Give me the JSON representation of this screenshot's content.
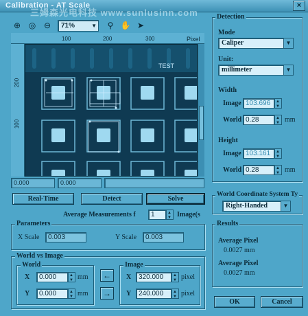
{
  "window": {
    "title": "Calibration - AT Scale",
    "watermark": "三姆森光电科技 www.sunlusinn.com",
    "close_label": "×"
  },
  "toolbar": {
    "zoom": "71%",
    "pixel_label": "Pixel"
  },
  "ruler": {
    "x": [
      "100",
      "200",
      "300"
    ],
    "y": [
      "200",
      "100"
    ]
  },
  "image": {
    "annotation": "TEST"
  },
  "status": {
    "a": "0.000",
    "b": "0.000"
  },
  "buttons": {
    "realtime": "Real-Time",
    "detect": "Detect",
    "solve": "Solve",
    "ok": "OK",
    "cancel": "Cancel",
    "arrow_left": "←",
    "arrow_right": "→"
  },
  "avg": {
    "label": "Average Measurements f",
    "value": "1",
    "suffix": "Image(s"
  },
  "parameters": {
    "title": "Parameters",
    "x_label": "X Scale",
    "x_value": "0.003",
    "y_label": "Y Scale",
    "y_value": "0.003"
  },
  "world_vs_image": {
    "title": "World vs Image",
    "world_title": "World",
    "x_label": "X",
    "x_value": "0.000",
    "y_label": "Y",
    "y_value": "0.000",
    "unit": "mm",
    "image_title": "Image",
    "ix_label": "X",
    "ix_value": "320.000",
    "iy_label": "Y",
    "iy_value": "240.000",
    "iunit": "pixel"
  },
  "detection": {
    "title": "Detection",
    "mode_label": "Mode",
    "mode_value": "Caliper",
    "unit_label": "Unit:",
    "unit_value": "millimeter",
    "width_label": "Width",
    "width_image_label": "Image",
    "width_image_value": "103.696",
    "width_world_label": "World",
    "width_world_value": "0.28",
    "width_world_unit": "mm",
    "height_label": "Height",
    "height_image_label": "Image",
    "height_image_value": "103.161",
    "height_world_label": "World",
    "height_world_value": "0.28",
    "height_world_unit": "mm"
  },
  "coord_system": {
    "title": "World Coordinate System Ty",
    "value": "Right-Handed"
  },
  "results": {
    "title": "Results",
    "avg1_label": "Average Pixel",
    "avg1_value": "0.0027 mm",
    "avg2_label": "Average Pixel",
    "avg2_value": "0.0027 mm"
  },
  "colors": {
    "background": "#4ea6c9",
    "image_bg": "#0f3a52",
    "pad": "#9fd9f0",
    "overlay": "#c9ecff"
  },
  "icons": [
    "zoom-in-icon",
    "zoom-reset-icon",
    "zoom-out-icon",
    "magnifier-icon",
    "pan-hand-icon",
    "pointer-arrow-icon"
  ]
}
